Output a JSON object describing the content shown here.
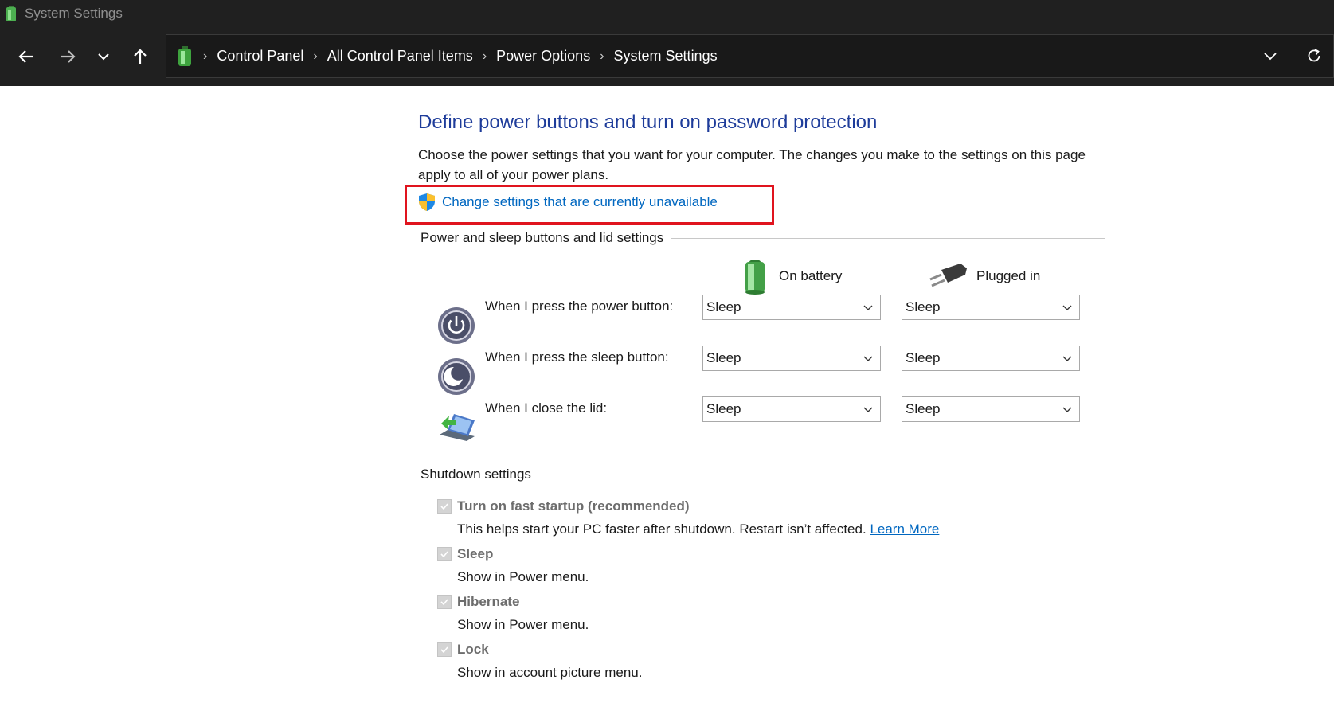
{
  "window": {
    "title": "System Settings"
  },
  "breadcrumb": {
    "items": [
      "Control Panel",
      "All Control Panel Items",
      "Power Options",
      "System Settings"
    ]
  },
  "page": {
    "heading": "Define power buttons and turn on password protection",
    "description": "Choose the power settings that you want for your computer. The changes you make to the settings on this page apply to all of your power plans.",
    "change_link": "Change settings that are currently unavailable"
  },
  "power_group": {
    "label": "Power and sleep buttons and lid settings",
    "col_battery": "On battery",
    "col_plugged": "Plugged in",
    "rows": [
      {
        "label": "When I press the power button:",
        "battery": "Sleep",
        "plugged": "Sleep"
      },
      {
        "label": "When I press the sleep button:",
        "battery": "Sleep",
        "plugged": "Sleep"
      },
      {
        "label": "When I close the lid:",
        "battery": "Sleep",
        "plugged": "Sleep"
      }
    ]
  },
  "shutdown_group": {
    "label": "Shutdown settings",
    "items": [
      {
        "label": "Turn on fast startup (recommended)",
        "desc": "This helps start your PC faster after shutdown. Restart isn’t affected.",
        "link": "Learn More",
        "checked": true
      },
      {
        "label": "Sleep",
        "desc": "Show in Power menu.",
        "checked": true
      },
      {
        "label": "Hibernate",
        "desc": "Show in Power menu.",
        "checked": true
      },
      {
        "label": "Lock",
        "desc": "Show in account picture menu.",
        "checked": true
      }
    ]
  },
  "colors": {
    "heading": "#1e3c9a",
    "link": "#0067c0",
    "highlight": "#e0141e",
    "chrome": "#202020"
  }
}
